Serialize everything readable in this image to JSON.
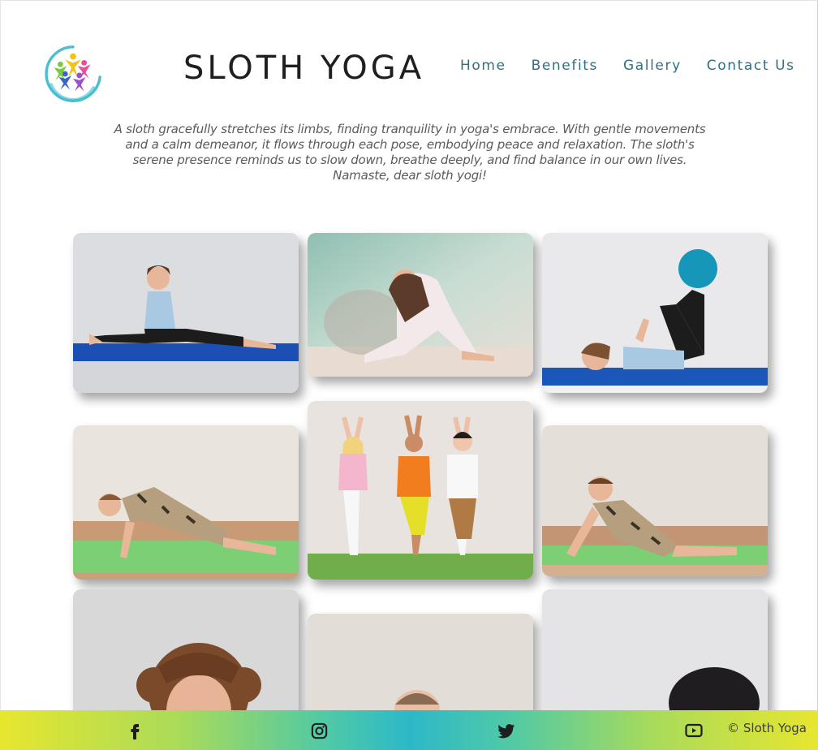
{
  "header": {
    "brand": "SLOTH YOGA",
    "nav": [
      "Home",
      "Benefits",
      "Gallery",
      "Contact Us"
    ]
  },
  "intro": "A sloth gracefully stretches its limbs, finding tranquility in yoga's embrace. With gentle movements and a calm demeanor, it flows through each pose, embodying peace and relaxation. The sloth's serene presence reminds us to slow down, breathe deeply, and find balance in our own lives. Namaste, dear sloth yogi!",
  "gallery": [
    {
      "name": "girl-split-photo"
    },
    {
      "name": "girl-backbend-photo"
    },
    {
      "name": "boy-ball-photo"
    },
    {
      "name": "boy-plank-photo"
    },
    {
      "name": "kids-tree-pose-photo"
    },
    {
      "name": "boy-cobra-photo"
    },
    {
      "name": "curly-girl-photo"
    },
    {
      "name": "boy-photo"
    },
    {
      "name": "dark-hair-kid-photo"
    }
  ],
  "footer": {
    "icons": [
      "facebook-icon",
      "instagram-icon",
      "twitter-icon",
      "youtube-icon"
    ],
    "copyright": "© Sloth Yoga"
  },
  "colors": {
    "nav_text": "#2f7083",
    "brand_text": "#1f1f1f",
    "intro_text": "#5a5a5a",
    "footer_gradient_edge": "#e7e62f",
    "footer_gradient_center": "#2cb8c9"
  }
}
